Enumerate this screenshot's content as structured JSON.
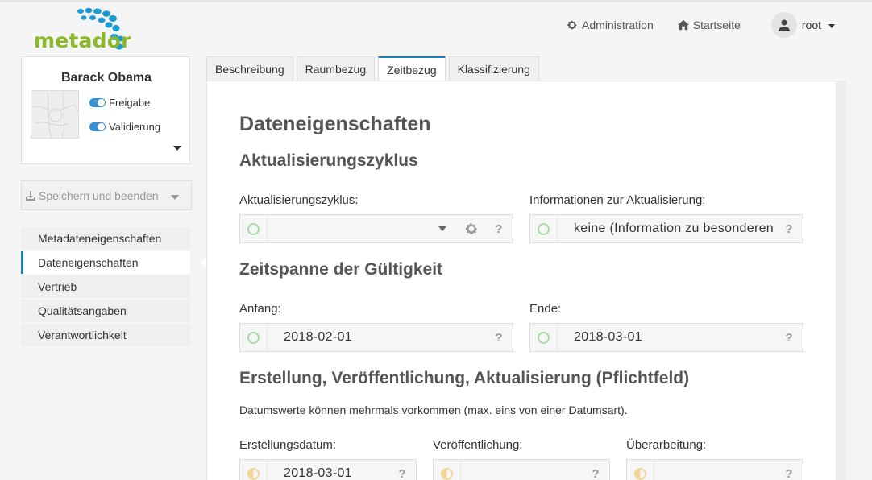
{
  "brand": {
    "name": "metador"
  },
  "topnav": {
    "admin": "Administration",
    "home": "Startseite",
    "user": "root"
  },
  "card": {
    "title": "Barack Obama",
    "toggle_release": "Freigabe",
    "toggle_validation": "Validierung"
  },
  "save_button": "Speichern und beenden",
  "sidenav": [
    {
      "label": "Metadateneigenschaften"
    },
    {
      "label": "Dateneigenschaften"
    },
    {
      "label": "Vertrieb"
    },
    {
      "label": "Qualitätsangaben"
    },
    {
      "label": "Verantwortlichkeit"
    }
  ],
  "tabs": [
    {
      "label": "Beschreibung"
    },
    {
      "label": "Raumbezug"
    },
    {
      "label": "Zeitbezug"
    },
    {
      "label": "Klassifizierung"
    }
  ],
  "main": {
    "title": "Dateneigenschaften",
    "section_update": "Aktualisierungszyklus",
    "label_cycle": "Aktualisierungszyklus:",
    "cycle_value": "",
    "label_update_info": "Informationen zur Aktualisierung:",
    "update_info_value": "keine (Information zu besonderen",
    "section_validity": "Zeitspanne der Gültigkeit",
    "label_start": "Anfang:",
    "start_value": "2018-02-01",
    "label_end": "Ende:",
    "end_value": "2018-03-01",
    "section_dates": "Erstellung, Veröffentlichung, Aktualisierung (Pflichtfeld)",
    "dates_note": "Datumswerte können mehrmals vorkommen (max. eins von einer Datumsart).",
    "label_created": "Erstellungsdatum:",
    "created_value": "2018-03-01",
    "label_published": "Veröffentlichung:",
    "published_value": "",
    "label_revised": "Überarbeitung:",
    "revised_value": "",
    "help": "?"
  },
  "colors": {
    "accent": "#1f7cb3",
    "logo_green": "#8ab82a",
    "logo_blue": "#1b9ad6",
    "valid_green": "#a8dba8",
    "pending_yellow": "#f3d79a"
  }
}
